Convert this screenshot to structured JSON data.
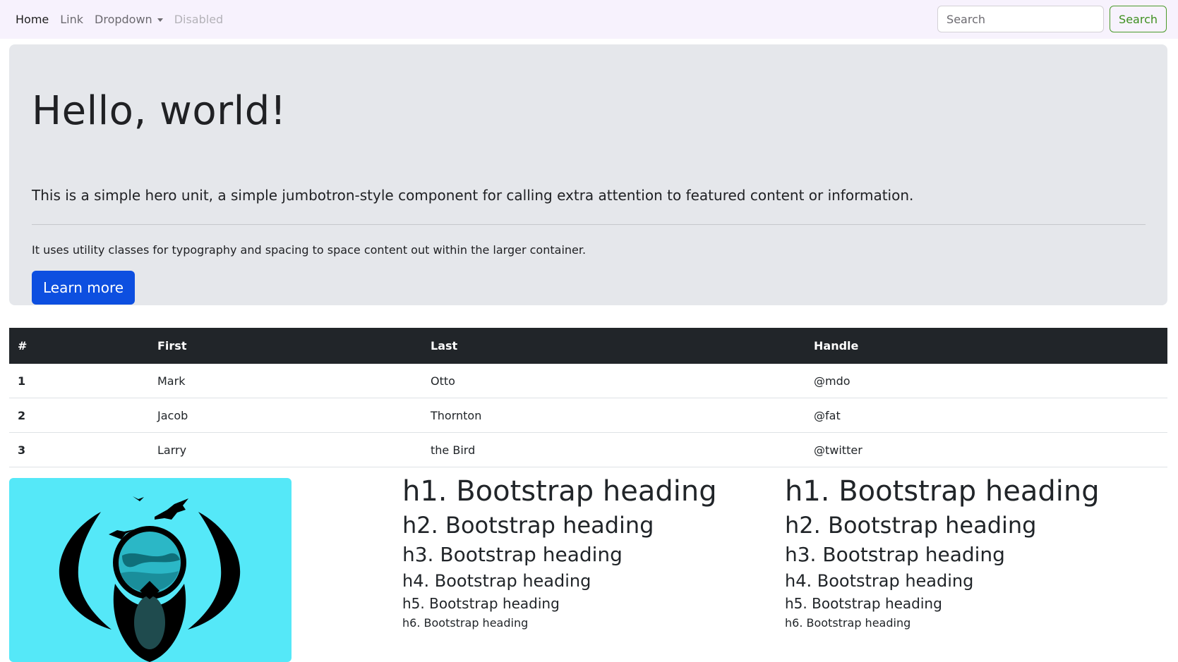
{
  "navbar": {
    "links": [
      {
        "label": "Home",
        "state": "active"
      },
      {
        "label": "Link",
        "state": "normal"
      },
      {
        "label": "Dropdown",
        "state": "normal"
      },
      {
        "label": "Disabled",
        "state": "disabled"
      }
    ],
    "search": {
      "placeholder": "Search",
      "button_label": "Search"
    }
  },
  "hero": {
    "title": "Hello, world!",
    "lead": "This is a simple hero unit, a simple jumbotron-style component for calling extra attention to featured content or information.",
    "text": "It uses utility classes for typography and spacing to space content out within the larger container.",
    "button_label": "Learn more"
  },
  "table": {
    "headers": [
      "#",
      "First",
      "Last",
      "Handle"
    ],
    "rows": [
      [
        "1",
        "Mark",
        "Otto",
        "@mdo"
      ],
      [
        "2",
        "Jacob",
        "Thornton",
        "@fat"
      ],
      [
        "3",
        "Larry",
        "the Bird",
        "@twitter"
      ]
    ]
  },
  "headings": [
    "h1. Bootstrap heading",
    "h2. Bootstrap heading",
    "h3. Bootstrap heading",
    "h4. Bootstrap heading",
    "h5. Bootstrap heading",
    "h6. Bootstrap heading"
  ],
  "colors": {
    "navbar_bg": "#f7f2fd",
    "hero_bg": "#e5e7eb",
    "primary": "#0d4fe0",
    "success": "#3d8f1f",
    "table_head_bg": "#212529",
    "logo_bg": "#55e8f8"
  },
  "logo": {
    "icon": "eagle-emblem-icon"
  }
}
